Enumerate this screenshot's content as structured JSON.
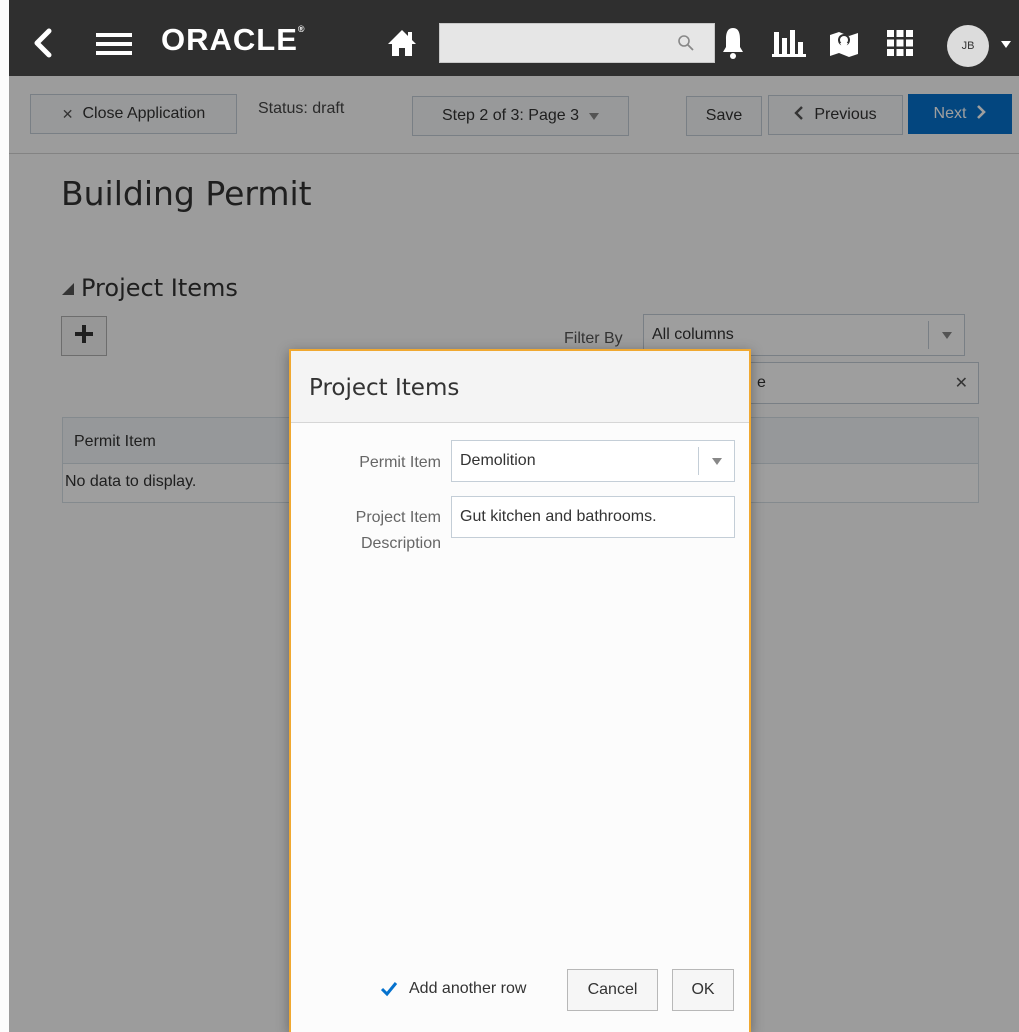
{
  "topbar": {
    "logo": "ORACLE",
    "search": {
      "value": "",
      "placeholder": ""
    },
    "avatar_initials": "JB",
    "icons": [
      "back-chevron-icon",
      "hamburger-menu-icon",
      "home-icon",
      "search-icon",
      "bell-icon",
      "bar-chart-icon",
      "map-icon",
      "grid-apps-icon",
      "caret-down-icon"
    ]
  },
  "toolbar": {
    "close_label": "Close Application",
    "status_label": "Status: draft",
    "step_label": "Step 2 of 3: Page 3",
    "save_label": "Save",
    "previous_label": "Previous",
    "next_label": "Next"
  },
  "page": {
    "title": "Building Permit",
    "section_title": "Project Items",
    "filter": {
      "label": "Filter By",
      "selected": "All columns",
      "input_value": "e"
    },
    "table": {
      "columns": [
        "Permit Item"
      ],
      "empty_message": "No data to display."
    }
  },
  "modal": {
    "title": "Project Items",
    "fields": {
      "permit_item_label": "Permit Item",
      "permit_item_value": "Demolition",
      "description_label_line1": "Project Item",
      "description_label_line2": "Description",
      "description_value": "Gut kitchen and bathrooms."
    },
    "add_another_label": "Add another row",
    "add_another_checked": true,
    "cancel_label": "Cancel",
    "ok_label": "OK"
  },
  "colors": {
    "topbar_bg": "#2f2f2f",
    "primary_button": "#0572ce",
    "modal_border": "#f0a830",
    "checkbox": "#0572ce"
  }
}
